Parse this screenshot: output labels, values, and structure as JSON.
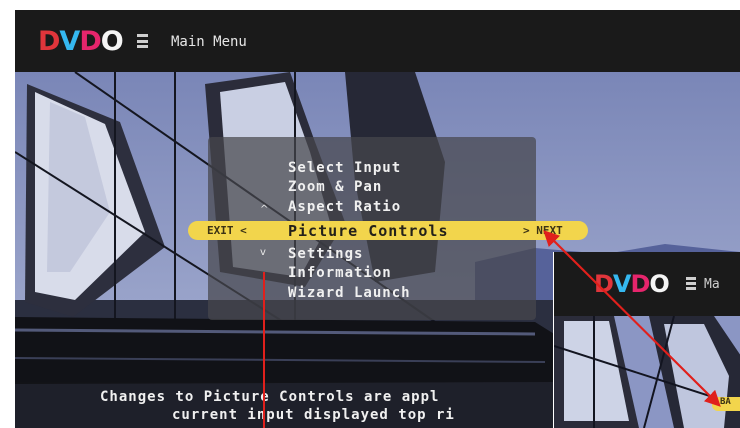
{
  "header": {
    "logo_letters": [
      "D",
      "V",
      "D",
      "O"
    ],
    "title": "Main Menu"
  },
  "menu": {
    "items": [
      {
        "label": "Select Input"
      },
      {
        "label": "Zoom & Pan"
      },
      {
        "label": "Aspect Ratio"
      },
      {
        "label": "Picture Controls",
        "selected": true
      },
      {
        "label": "Settings"
      },
      {
        "label": "Information"
      },
      {
        "label": "Wizard Launch"
      }
    ],
    "nav_left": "EXIT <",
    "nav_right": "> NEXT",
    "arrow_up": "^",
    "arrow_down": "v"
  },
  "footer": {
    "line1": "Changes to Picture Controls are appl",
    "line2": "current input displayed top ri"
  },
  "inset": {
    "logo_letters": [
      "D",
      "V",
      "D",
      "O"
    ],
    "title": "Ma",
    "highlight_text": "BA"
  },
  "colors": {
    "accent_yellow": "#f2d54c",
    "annotation_red": "#e0201c",
    "logo_red": "#e0353b",
    "logo_blue": "#35b8f0",
    "logo_pink": "#e6256c"
  },
  "icons": [
    "hamburger-icon",
    "up-arrow-icon",
    "down-arrow-icon"
  ]
}
